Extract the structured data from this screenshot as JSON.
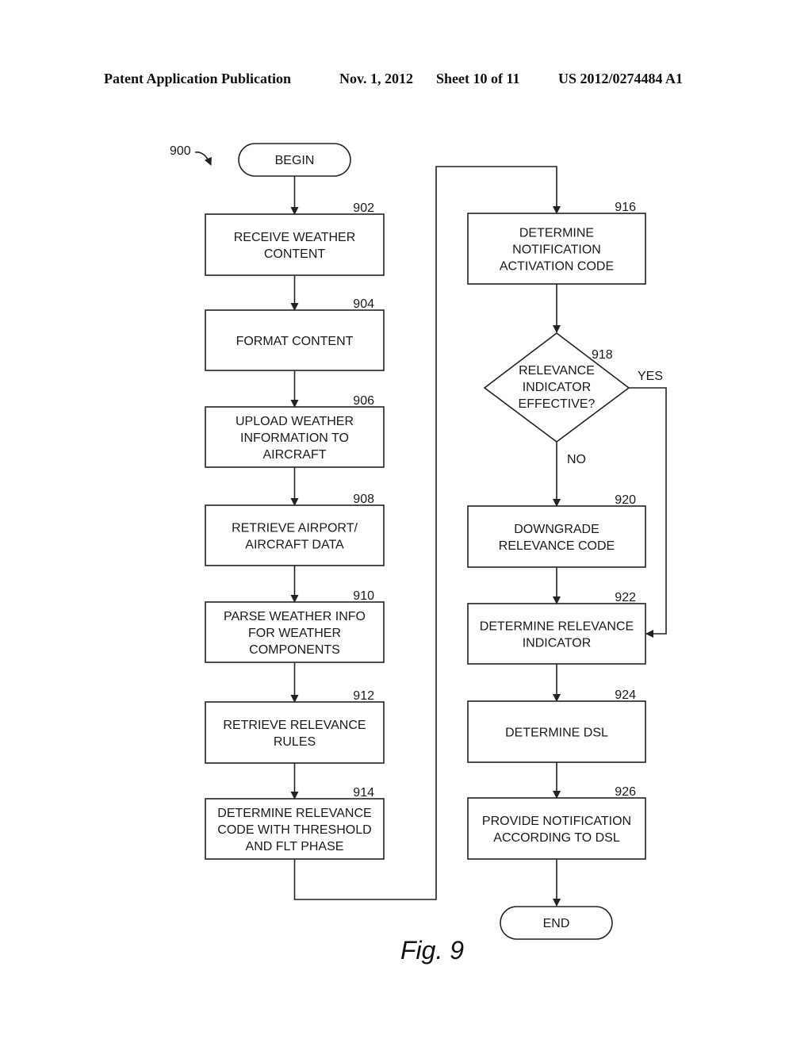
{
  "header": {
    "publication": "Patent Application Publication",
    "date": "Nov. 1, 2012",
    "sheet": "Sheet 10 of 11",
    "patent_number": "US 2012/0274484 A1"
  },
  "diagram": {
    "reference": "900",
    "begin": "BEGIN",
    "end": "END",
    "figure_label": "Fig. 9",
    "steps": [
      {
        "id": "902",
        "lines": [
          "RECEIVE WEATHER",
          "CONTENT"
        ]
      },
      {
        "id": "904",
        "lines": [
          "FORMAT CONTENT"
        ]
      },
      {
        "id": "906",
        "lines": [
          "UPLOAD WEATHER",
          "INFORMATION TO",
          "AIRCRAFT"
        ]
      },
      {
        "id": "908",
        "lines": [
          "RETRIEVE AIRPORT/",
          "AIRCRAFT DATA"
        ]
      },
      {
        "id": "910",
        "lines": [
          "PARSE WEATHER INFO",
          "FOR WEATHER",
          "COMPONENTS"
        ]
      },
      {
        "id": "912",
        "lines": [
          "RETRIEVE RELEVANCE",
          "RULES"
        ]
      },
      {
        "id": "914",
        "lines": [
          "DETERMINE RELEVANCE",
          "CODE WITH THRESHOLD",
          "AND FLT PHASE"
        ]
      },
      {
        "id": "916",
        "lines": [
          "DETERMINE",
          "NOTIFICATION",
          "ACTIVATION CODE"
        ]
      },
      {
        "id": "920",
        "lines": [
          "DOWNGRADE",
          "RELEVANCE CODE"
        ]
      },
      {
        "id": "922",
        "lines": [
          "DETERMINE RELEVANCE",
          "INDICATOR"
        ]
      },
      {
        "id": "924",
        "lines": [
          "DETERMINE DSL"
        ]
      },
      {
        "id": "926",
        "lines": [
          "PROVIDE NOTIFICATION",
          "ACCORDING TO DSL"
        ]
      }
    ],
    "decision": {
      "id": "918",
      "lines": [
        "RELEVANCE",
        "INDICATOR",
        "EFFECTIVE?"
      ],
      "yes_label": "YES",
      "no_label": "NO"
    }
  }
}
